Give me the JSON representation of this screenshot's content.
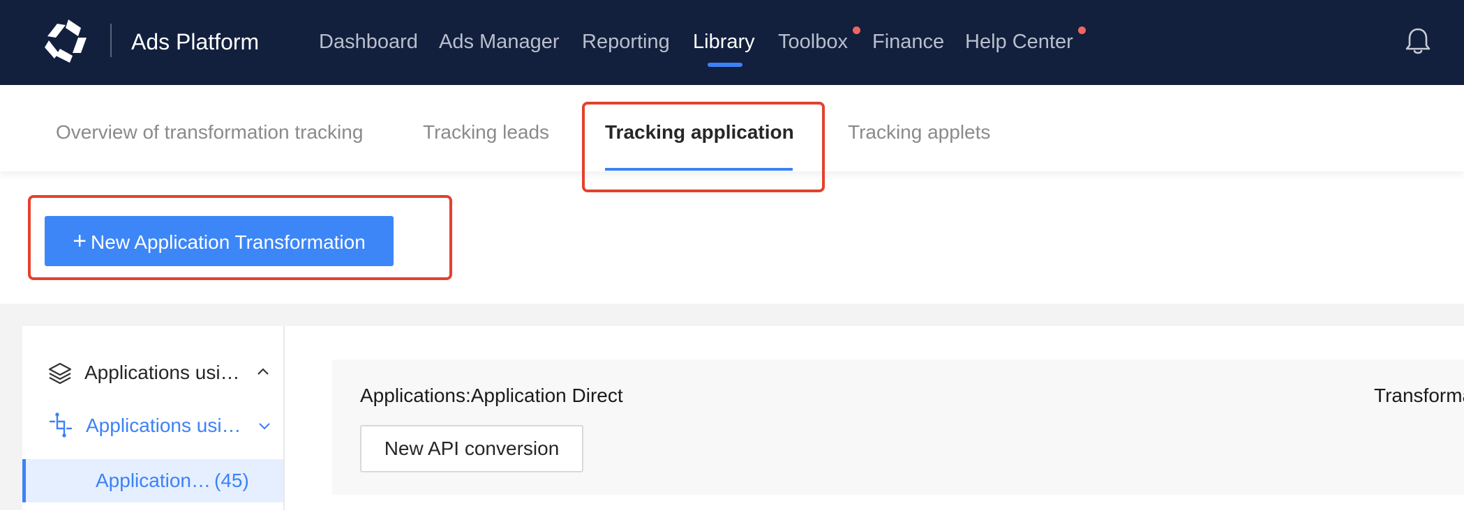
{
  "topbar": {
    "brand": "Ads Platform",
    "nav": [
      {
        "label": "Dashboard",
        "active": false
      },
      {
        "label": "Ads Manager",
        "active": false
      },
      {
        "label": "Reporting",
        "active": false
      },
      {
        "label": "Library",
        "active": true
      },
      {
        "label": "Toolbox",
        "active": false,
        "notification_dot": true
      },
      {
        "label": "Finance",
        "active": false
      },
      {
        "label": "Help Center",
        "active": false,
        "notification_dot": true
      }
    ],
    "icons": {
      "logo": "brand-logo-icon",
      "bell": "bell-icon"
    },
    "colors": {
      "background": "#121f3d",
      "accent": "#3c82f6",
      "dot": "#f0665e"
    }
  },
  "subtabs": [
    {
      "label": "Overview of transformation tracking",
      "active": false
    },
    {
      "label": "Tracking leads",
      "active": false
    },
    {
      "label": "Tracking application",
      "active": true
    },
    {
      "label": "Tracking applets",
      "active": false
    }
  ],
  "actions": {
    "new_button": "New Application Transformation"
  },
  "sidebar": {
    "items": [
      {
        "label": "Applications usi…",
        "icon": "layers-icon",
        "expanded": true,
        "chevron": "chevron-up-icon"
      },
      {
        "label": "Applications usi…",
        "icon": "api-link-icon",
        "selected": true,
        "chevron": "chevron-down-icon"
      }
    ],
    "sub_item": {
      "label": "Application…",
      "count": "(45)"
    }
  },
  "card": {
    "title": "Applications:Application Direct",
    "right_label": "Transformation",
    "button": "New API conversion"
  }
}
